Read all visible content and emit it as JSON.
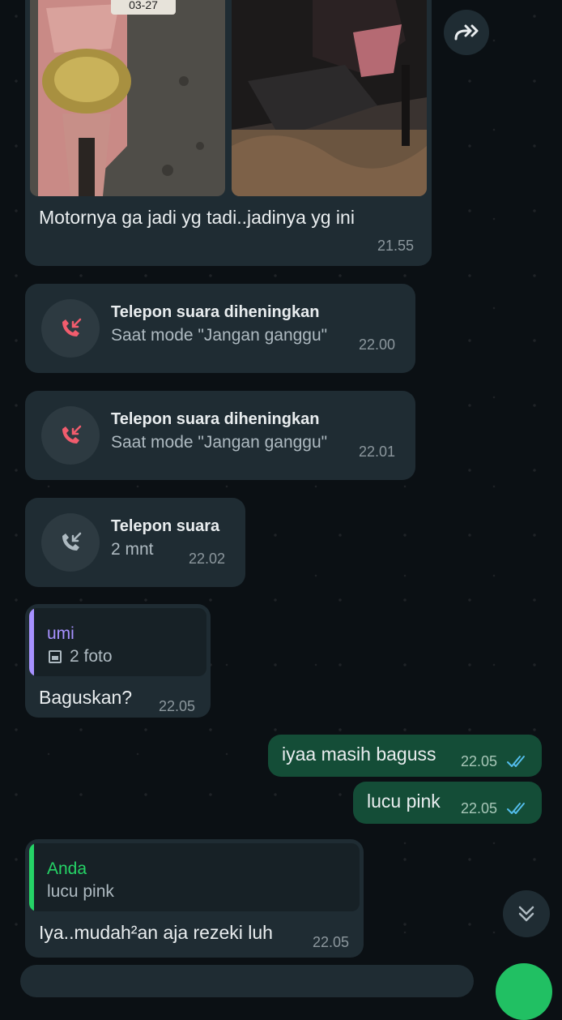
{
  "messages": {
    "photo_message": {
      "caption": "Motornya ga jadi yg tadi..jadinya yg ini",
      "time": "21.55",
      "plate_text": "03-27"
    },
    "call1": {
      "title": "Telepon suara diheningkan",
      "subtitle": "Saat mode \"Jangan ganggu\"",
      "time": "22.00"
    },
    "call2": {
      "title": "Telepon suara diheningkan",
      "subtitle": "Saat mode \"Jangan ganggu\"",
      "time": "22.01"
    },
    "call3": {
      "title": "Telepon suara",
      "subtitle": "2 mnt",
      "time": "22.02"
    },
    "reply_in": {
      "quote_author": "umi",
      "quote_text": "2 foto",
      "text": "Baguskan?",
      "time": "22.05"
    },
    "out1": {
      "text": "iyaa masih baguss",
      "time": "22.05"
    },
    "out2": {
      "text": "lucu pink",
      "time": "22.05"
    },
    "reply_in2": {
      "quote_author": "Anda",
      "quote_text": "lucu pink",
      "text": "Iya..mudah²an aja rezeki luh",
      "time": "22.05"
    }
  },
  "icons": {
    "forward": "forward-icon",
    "missed_call": "missed-call-icon",
    "incoming_call": "incoming-call-icon",
    "photo": "photo-icon",
    "read_receipt": "double-check-icon",
    "scroll_down": "chevron-double-down-icon"
  },
  "colors": {
    "incoming_bubble": "#1f2c33",
    "outgoing_bubble": "#144d37",
    "missed_red": "#f15c6d",
    "quote_umi_bar": "#a791ff",
    "quote_anda_bar": "#25d366",
    "read_tick_blue": "#53bdeb"
  }
}
